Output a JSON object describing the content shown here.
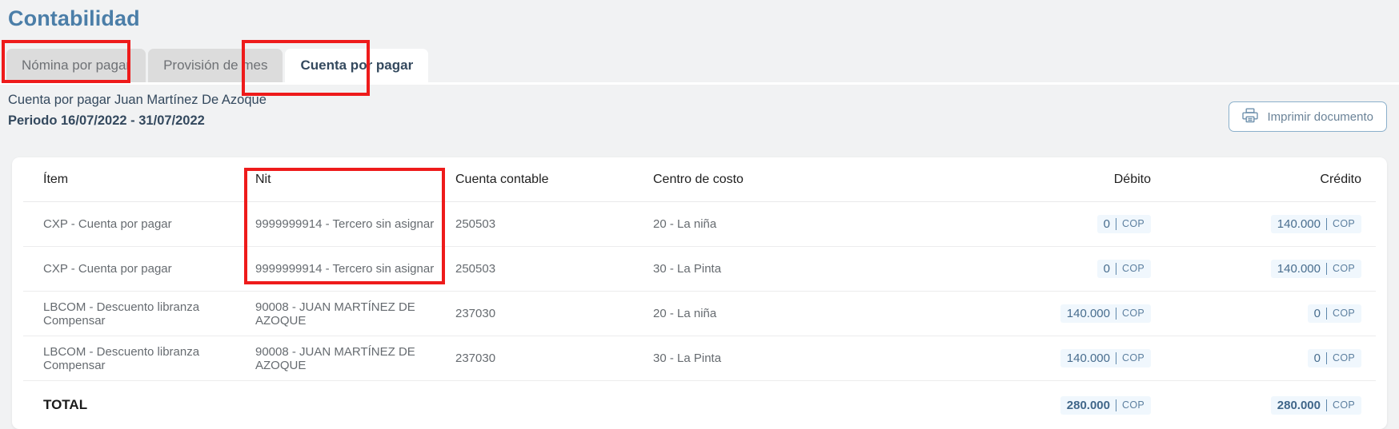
{
  "page_title": "Contabilidad",
  "tabs": [
    {
      "label": "Nómina por pagar",
      "active": false
    },
    {
      "label": "Provisión de mes",
      "active": false
    },
    {
      "label": "Cuenta por pagar",
      "active": true
    }
  ],
  "subheader": {
    "line1": "Cuenta por pagar Juan Martínez De Azoque",
    "line2": "Periodo 16/07/2022 - 31/07/2022"
  },
  "print_button": {
    "label": "Imprimir documento",
    "icon": "printer-icon"
  },
  "table": {
    "headers": {
      "item": "Ítem",
      "nit": "Nit",
      "cuenta": "Cuenta contable",
      "centro": "Centro de costo",
      "debito": "Débito",
      "credito": "Crédito"
    },
    "rows": [
      {
        "item": "CXP - Cuenta por pagar",
        "nit": "9999999914 - Tercero sin asignar",
        "cuenta": "250503",
        "centro": "20 - La niña",
        "debito": "0",
        "debito_currency": "COP",
        "credito": "140.000",
        "credito_currency": "COP"
      },
      {
        "item": "CXP - Cuenta por pagar",
        "nit": "9999999914 - Tercero sin asignar",
        "cuenta": "250503",
        "centro": "30 - La Pinta",
        "debito": "0",
        "debito_currency": "COP",
        "credito": "140.000",
        "credito_currency": "COP"
      },
      {
        "item": "LBCOM - Descuento libranza Compensar",
        "nit": "90008 - JUAN MARTÍNEZ DE AZOQUE",
        "cuenta": "237030",
        "centro": "20 - La niña",
        "debito": "140.000",
        "debito_currency": "COP",
        "credito": "0",
        "credito_currency": "COP"
      },
      {
        "item": "LBCOM - Descuento libranza Compensar",
        "nit": "90008 - JUAN MARTÍNEZ DE AZOQUE",
        "cuenta": "237030",
        "centro": "30 - La Pinta",
        "debito": "140.000",
        "debito_currency": "COP",
        "credito": "0",
        "credito_currency": "COP"
      }
    ],
    "total": {
      "label": "TOTAL",
      "debito": "280.000",
      "debito_currency": "COP",
      "credito": "280.000",
      "credito_currency": "COP"
    }
  },
  "colors": {
    "title_blue": "#4b7ea8",
    "annotation_red": "#ee1b1b",
    "badge_bg": "#f0f7fd",
    "badge_text": "#486d8e",
    "page_bg": "#f1f2f3"
  }
}
